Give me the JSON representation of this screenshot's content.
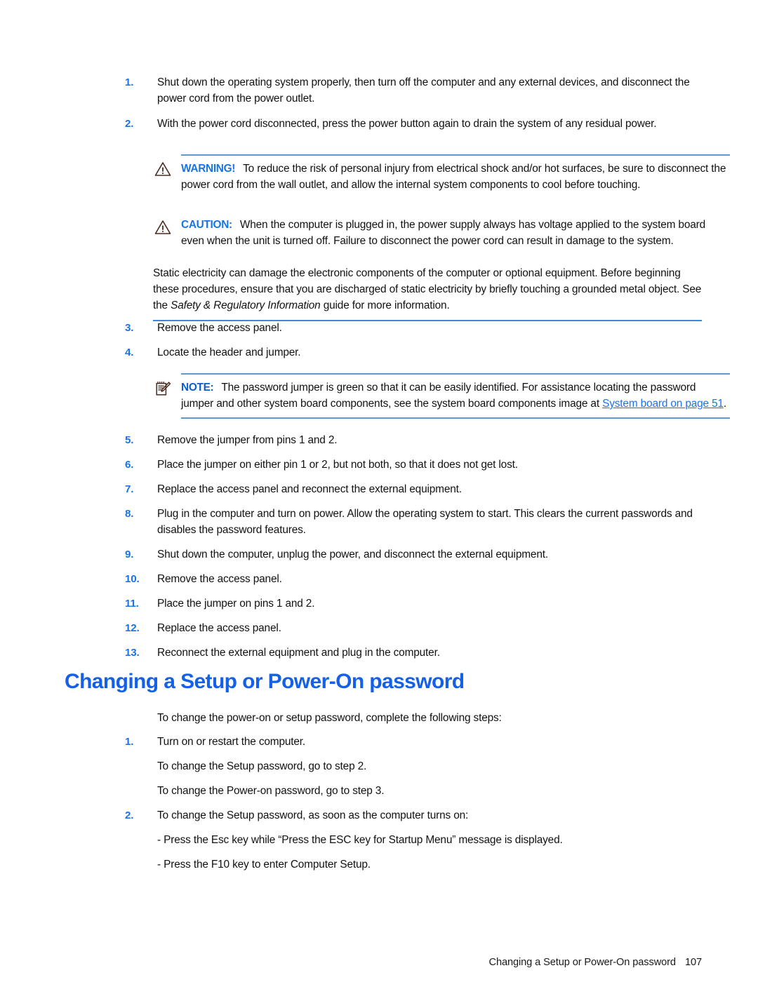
{
  "document": {
    "page_number": "107",
    "footer_title": "Changing a Setup or Power-On password"
  },
  "colors": {
    "accent_blue": "#1974e8",
    "heading_blue": "#1461e8",
    "rule_blue": "#5b9bd5",
    "link_blue": "#1a73e8",
    "icon_outline": "#4a2a20"
  },
  "top_steps": [
    {
      "number": "1.",
      "text": "Shut down the operating system properly, then turn off the computer and any external devices, and disconnect the power cord from the power outlet."
    },
    {
      "number": "2.",
      "text": "With the power cord disconnected, press the power button again to drain the system of any residual power."
    }
  ],
  "warning": {
    "icon": "warning-triangle-icon",
    "label": "WARNING!",
    "text": "To reduce the risk of personal injury from electrical shock and/or hot surfaces, be sure to disconnect the power cord from the wall outlet, and allow the internal system components to cool before touching."
  },
  "caution": {
    "icon": "caution-triangle-icon",
    "label": "CAUTION:",
    "text": "When the computer is plugged in, the power supply always has voltage applied to the system board even when the unit is turned off. Failure to disconnect the power cord can result in damage to the system."
  },
  "static_notice": {
    "text_before": "Static electricity can damage the electronic components of the computer or optional equipment. Before beginning these procedures, ensure that you are discharged of static electricity by briefly touching a grounded metal object. See the ",
    "italic_title": "Safety & Regulatory Information",
    "text_after": " guide for more information."
  },
  "mid_steps": [
    {
      "number": "3.",
      "text": "Remove the access panel."
    },
    {
      "number": "4.",
      "text": "Locate the header and jumper."
    }
  ],
  "note": {
    "icon": "note-pencil-icon",
    "label": "NOTE:",
    "text_before": "The password jumper is green so that it can be easily identified. For assistance locating the password jumper and other system board components, see the system board components image at ",
    "link_text": "System board on page 51",
    "text_after": "."
  },
  "lower_steps": [
    {
      "number": "5.",
      "text": "Remove the jumper from pins 1 and 2."
    },
    {
      "number": "6.",
      "text": "Place the jumper on either pin 1 or 2, but not both, so that it does not get lost."
    },
    {
      "number": "7.",
      "text": "Replace the access panel and reconnect the external equipment."
    },
    {
      "number": "8.",
      "text": "Plug in the computer and turn on power. Allow the operating system to start. This clears the current passwords and disables the password features."
    },
    {
      "number": "9.",
      "text": "Shut down the computer, unplug the power, and disconnect the external equipment."
    },
    {
      "number": "10.",
      "text": "Remove the access panel."
    },
    {
      "number": "11.",
      "text": "Place the jumper on pins 1 and 2."
    },
    {
      "number": "12.",
      "text": "Replace the access panel."
    },
    {
      "number": "13.",
      "text": "Reconnect the external equipment and plug in the computer."
    }
  ],
  "section": {
    "heading": "Changing a Setup or Power-On password",
    "intro": "To change the power-on or setup password, complete the following steps:",
    "steps": [
      {
        "number": "1.",
        "text": "Turn on or restart the computer.",
        "sub_lines": [
          "To change the Setup password, go to step 2.",
          "To change the Power-on password, go to step 3."
        ]
      },
      {
        "number": "2.",
        "text": "To change the Setup password, as soon as the computer turns on:",
        "sub_lines": [
          "- Press the Esc key while “Press the ESC key for Startup Menu” message is displayed.",
          "- Press the F10 key to enter Computer Setup."
        ]
      }
    ]
  }
}
